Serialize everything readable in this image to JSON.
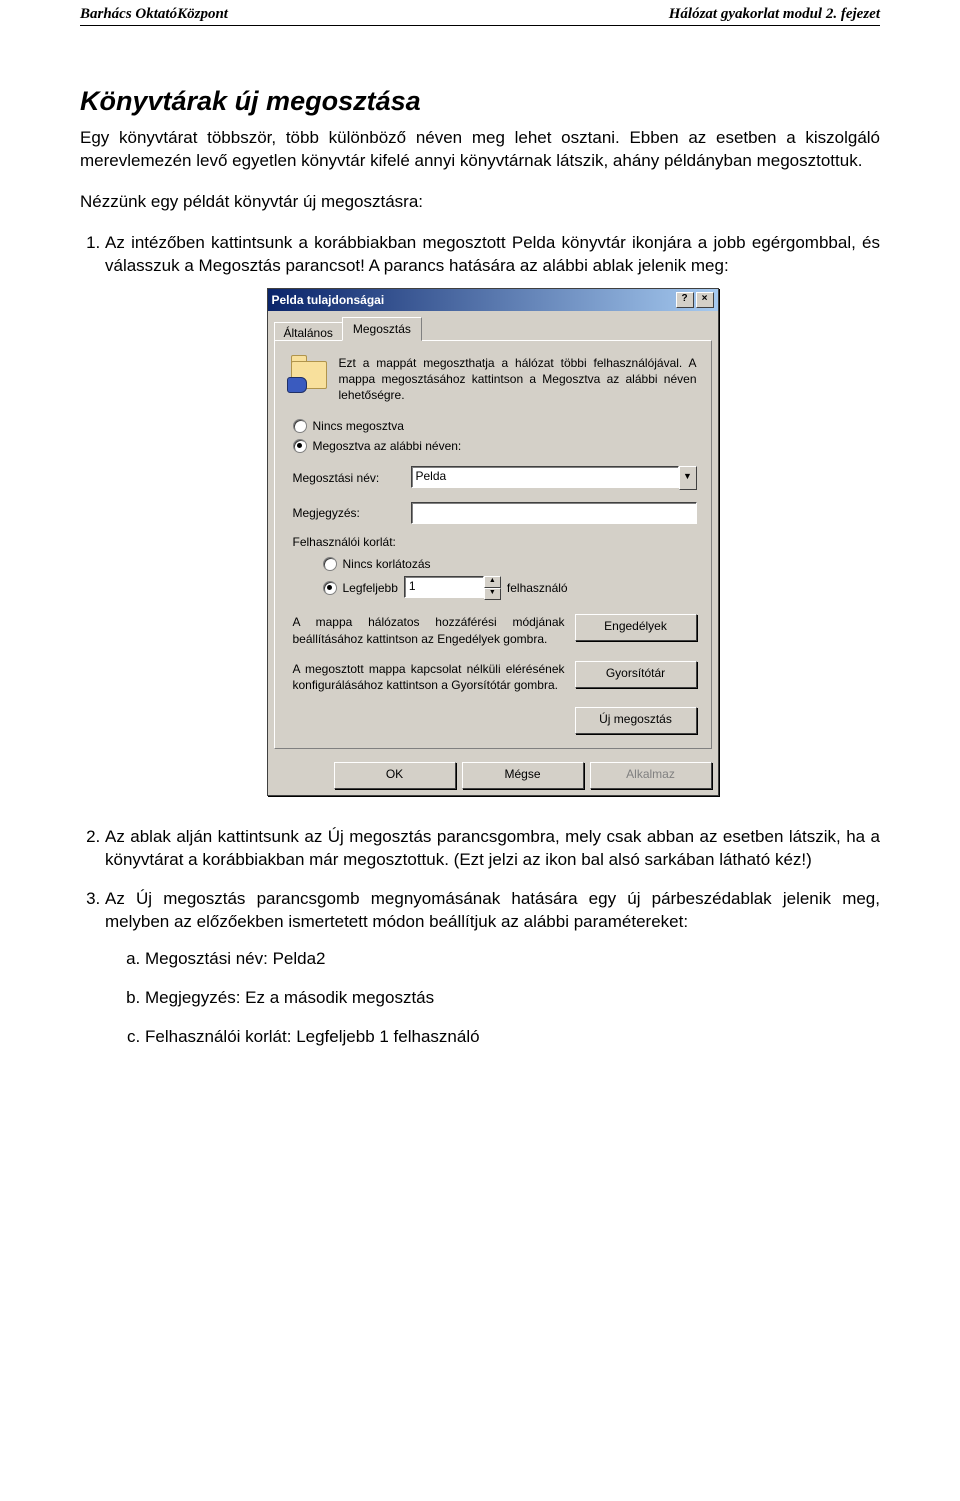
{
  "header": {
    "left": "Barhács OktatóKözpont",
    "right": "Hálózat gyakorlat modul 2. fejezet"
  },
  "title": "Könyvtárak új megosztása",
  "intro1": "Egy könyvtárat többször, több különböző néven meg lehet osztani. Ebben az esetben a kiszolgáló merevlemezén levő egyetlen könyvtár kifelé annyi könyvtárnak látszik, ahány példányban megosztottuk.",
  "intro2": "Nézzünk egy példát könyvtár új megosztásra:",
  "step1_pre": "Az intézőben kattintsunk a korábbiakban megosztott Pelda könyvtár ikonjára a ",
  "step1_bold1": "jobb egérgomb",
  "step1_mid": "bal, és válasszuk a ",
  "step1_bold2": "Megosztás",
  "step1_post": " parancsot! A parancs hatására az alábbi ablak jelenik meg:",
  "dialog": {
    "title": "Pelda tulajdonságai",
    "help": "?",
    "close": "×",
    "tabs": {
      "general": "Általános",
      "sharing": "Megosztás"
    },
    "info": "Ezt a mappát megoszthatja a hálózat többi felhasználójával. A mappa megosztásához kattintson a Megosztva az alábbi néven lehetőségre.",
    "radio_none": "Nincs megosztva",
    "radio_shared": "Megosztva az alábbi néven:",
    "label_sharename": "Megosztási név:",
    "value_sharename": "Pelda",
    "label_comment": "Megjegyzés:",
    "value_comment": "",
    "label_userlimit": "Felhasználói korlát:",
    "radio_nolimit": "Nincs korlátozás",
    "radio_max": "Legfeljebb",
    "value_max": "1",
    "suffix_users": "felhasználó",
    "perm_text": "A mappa hálózatos hozzáférési módjának beállításához kattintson az Engedélyek gombra.",
    "btn_permissions": "Engedélyek",
    "cache_text": "A megosztott mappa kapcsolat nélküli elérésének konfigurálásához kattintson a Gyorsítótár gombra.",
    "btn_cache": "Gyorsítótár",
    "btn_newshare": "Új megosztás",
    "btn_ok": "OK",
    "btn_cancel": "Mégse",
    "btn_apply": "Alkalmaz"
  },
  "step2_pre": "Az ablak alján kattintsunk az ",
  "step2_bold": "Új megosztás",
  "step2_post": " parancsgombra, mely csak abban az esetben látszik, ha a könyvtárat a korábbiakban már megosztottuk. (Ezt jelzi az ikon bal alsó sarkában látható kéz!)",
  "step3_pre": "Az ",
  "step3_bold": "Új megosztás",
  "step3_post": " parancsgomb megnyomásának hatására egy új párbeszédablak jelenik meg, melyben az előzőekben ismertetett módon beállítjuk az alábbi paramétereket:",
  "sub_a_label": "Megosztási név:",
  "sub_a_value": " Pelda2",
  "sub_b_label": "Megjegyzés:",
  "sub_b_value": " Ez a második megosztás",
  "sub_c_label": "Felhasználói korlát:",
  "sub_c_value": " Legfeljebb 1 felhasználó"
}
